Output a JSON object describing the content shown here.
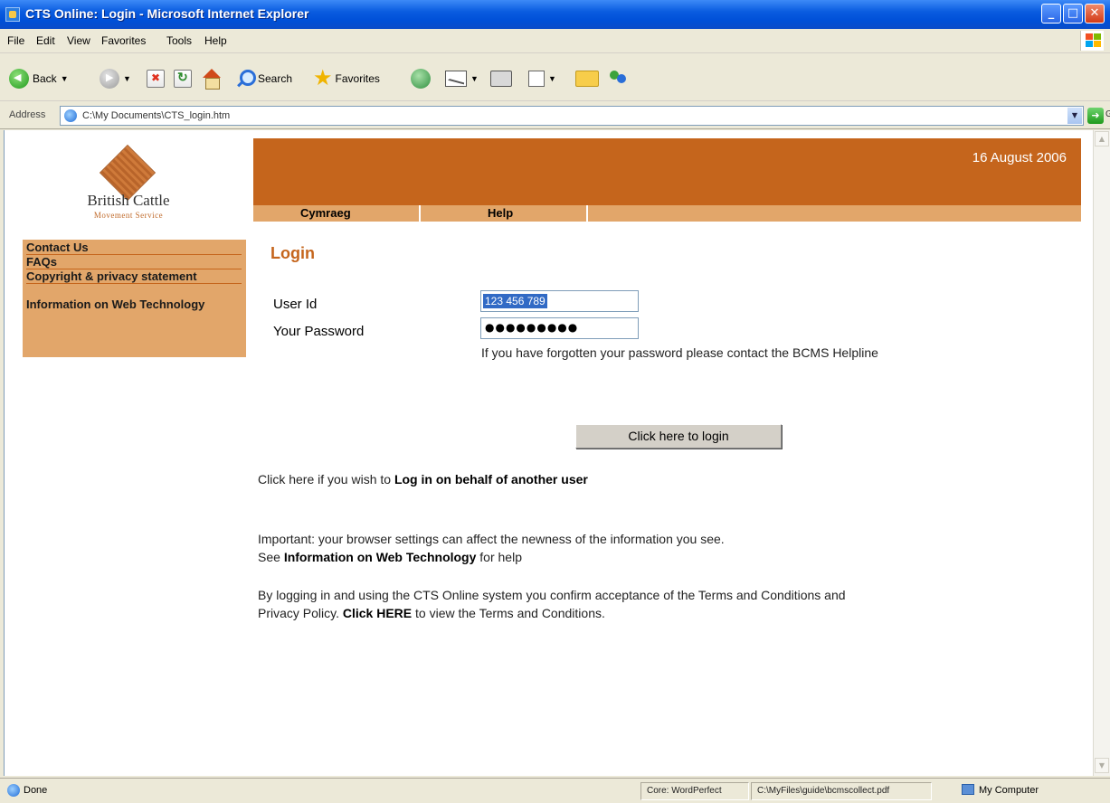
{
  "window": {
    "title": "CTS Online: Login - Microsoft Internet Explorer"
  },
  "menu": {
    "items": [
      "File",
      "Edit",
      "View",
      "Favorites",
      "Tools",
      "Help"
    ]
  },
  "toolbar": {
    "back_label": "Back",
    "search_label": "Search",
    "favorites_label": "Favorites"
  },
  "address": {
    "label": "Address",
    "url": "C:\\My Documents\\CTS_login.htm",
    "go_label": "Go"
  },
  "page": {
    "logo": {
      "name": "British Cattle",
      "subtitle": "Movement Service"
    },
    "date": "16 August 2006",
    "nav": [
      "Cymraeg",
      "Help"
    ],
    "sidebar": [
      "Contact Us",
      "FAQs",
      "Copyright & privacy statement",
      "Information on Web Technology"
    ],
    "heading": "Login",
    "form": {
      "user_label": "User Id",
      "user_value": "123 456 789",
      "password_label": "Your Password",
      "password_mask": "●●●●●●●●●",
      "hint": "If you have forgotten your password please contact the BCMS Helpline",
      "submit_label": "Click here to login"
    },
    "proxy": {
      "prefix": "Click here if you wish to ",
      "link": "Log in on behalf of another user"
    },
    "important": {
      "line1": "Important: your browser settings can affect the newness of the information you see.",
      "line2_prefix": "See ",
      "line2_link": "Information on Web Technology",
      "line2_suffix": " for help"
    },
    "terms": {
      "line1": "By logging in and using the CTS Online system you confirm acceptance of the Terms and Conditions and",
      "line2_prefix": "Privacy Policy. ",
      "line2_link": "Click HERE",
      "line2_suffix": " to view the Terms and Conditions."
    }
  },
  "status": {
    "text": "Done",
    "pane1": "Core: WordPerfect",
    "pane2": "C:\\MyFiles\\guide\\bcmscollect.pdf",
    "zone": "My Computer"
  }
}
